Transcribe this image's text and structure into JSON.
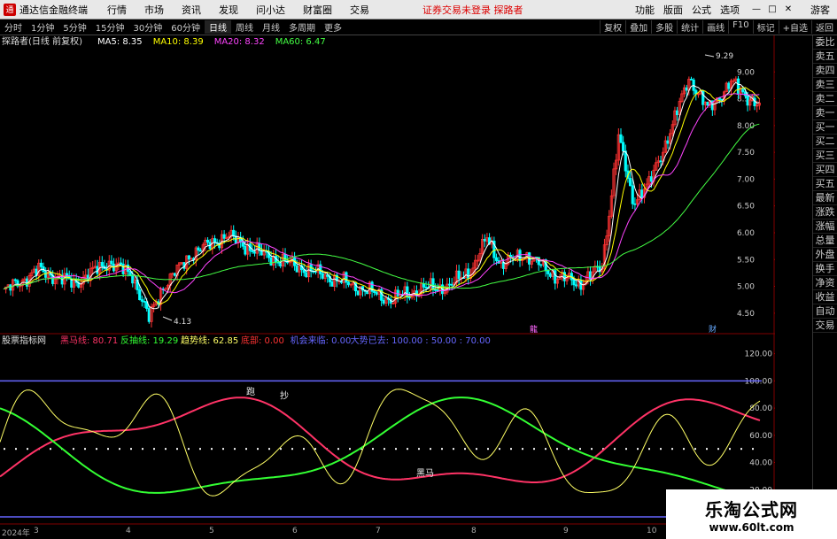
{
  "titlebar": {
    "app_name": "通达信金融终端",
    "menus": [
      "行情",
      "市场",
      "资讯",
      "发现",
      "问小达",
      "财富圈",
      "交易"
    ],
    "notice": "证券交易未登录  探路者",
    "right_menus": [
      "功能",
      "版面",
      "公式",
      "选项"
    ],
    "guest": "游客"
  },
  "toolbar": {
    "periods": [
      "分时",
      "1分钟",
      "5分钟",
      "15分钟",
      "30分钟",
      "60分钟",
      "日线",
      "周线",
      "月线",
      "多周期",
      "更多"
    ],
    "active_period": "日线",
    "tools": [
      "复权",
      "叠加",
      "多股",
      "统计",
      "画线",
      "F10",
      "标记",
      "+自选",
      "返回"
    ]
  },
  "main_chart": {
    "stock_label": "探路者(日线 前复权)",
    "ma_labels": [
      {
        "text": "MA5: 8.35",
        "color": "#ffffff"
      },
      {
        "text": "MA10: 8.39",
        "color": "#ffff00"
      },
      {
        "text": "MA20: 8.32",
        "color": "#ff44ff"
      },
      {
        "text": "MA60: 6.47",
        "color": "#44ff44"
      }
    ],
    "y_ticks": [
      "9.00",
      "8.50",
      "8.00",
      "7.50",
      "7.00",
      "6.50",
      "6.00",
      "5.50",
      "5.00",
      "4.50"
    ],
    "y_range": [
      4.2,
      9.45
    ],
    "high_label": "9.29",
    "low_label": "4.13",
    "markers": [
      "龍",
      "财"
    ]
  },
  "indicator": {
    "name": "股票指标网",
    "fields": [
      {
        "text": "黑马线: 80.71",
        "color": "#ff3366"
      },
      {
        "text": "反抽线: 19.29",
        "color": "#33ff33"
      },
      {
        "text": "趋势线: 62.85",
        "color": "#ffff66"
      },
      {
        "text": "底部: 0.00",
        "color": "#ff3333"
      },
      {
        "text": "机会来临: 0.00",
        "color": "#6666ff"
      },
      {
        "text": "大势已去: 100.00 : 50.00 : 70.00",
        "color": "#6666ff"
      }
    ],
    "y_ticks": [
      "120.00",
      "100.00",
      "80.00",
      "60.00",
      "40.00",
      "20.00"
    ],
    "y_range": [
      0,
      125
    ],
    "annotations": [
      "跑",
      "抄",
      "黑马"
    ]
  },
  "date_axis": {
    "labels": [
      "2024年",
      "3",
      "4",
      "5",
      "6",
      "7",
      "8",
      "9",
      "10"
    ]
  },
  "right_panel": {
    "items": [
      "委比",
      "卖五",
      "卖四",
      "卖三",
      "卖二",
      "卖一",
      "买一",
      "买二",
      "买三",
      "买四",
      "买五",
      "最新",
      "涨跌",
      "涨幅",
      "总量",
      "外盘",
      "换手",
      "净资",
      "收益",
      "自动",
      "交易"
    ]
  },
  "watermark": {
    "line1": "乐淘公式网",
    "line2": "www.60lt.com"
  },
  "colors": {
    "up": "#ff3333",
    "down": "#00ffff",
    "ma5": "#ffffff",
    "ma10": "#ffff00",
    "ma20": "#ff44ff",
    "ma60": "#44ff44",
    "heima": "#ff3366",
    "fanchou": "#33ff33",
    "trend": "#ffff66",
    "level": "#6666ff"
  }
}
